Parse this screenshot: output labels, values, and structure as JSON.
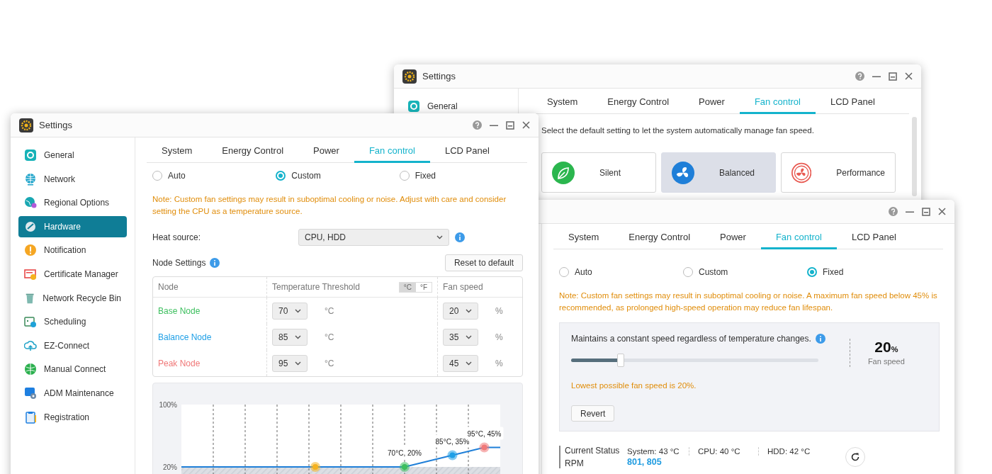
{
  "back_window": {
    "title": "Settings",
    "sidebar": {
      "items": [
        {
          "label": "General",
          "selected": false
        }
      ]
    },
    "tabs": [
      {
        "label": "System",
        "selected": false
      },
      {
        "label": "Energy Control",
        "selected": false
      },
      {
        "label": "Power",
        "selected": false
      },
      {
        "label": "Fan control",
        "selected": true
      },
      {
        "label": "LCD Panel",
        "selected": false
      }
    ],
    "description": "Select the default setting to let the system automatically manage fan speed.",
    "presets": [
      {
        "label": "Silent",
        "selected": false
      },
      {
        "label": "Balanced",
        "selected": true
      },
      {
        "label": "Performance",
        "selected": false
      }
    ]
  },
  "left_window": {
    "title": "Settings",
    "sidebar": {
      "items": [
        {
          "label": "General",
          "selected": false
        },
        {
          "label": "Network",
          "selected": false
        },
        {
          "label": "Regional Options",
          "selected": false
        },
        {
          "label": "Hardware",
          "selected": true
        },
        {
          "label": "Notification",
          "selected": false
        },
        {
          "label": "Certificate Manager",
          "selected": false
        },
        {
          "label": "Network Recycle Bin",
          "selected": false
        },
        {
          "label": "Scheduling",
          "selected": false
        },
        {
          "label": "EZ-Connect",
          "selected": false
        },
        {
          "label": "Manual Connect",
          "selected": false
        },
        {
          "label": "ADM Maintenance",
          "selected": false
        },
        {
          "label": "Registration",
          "selected": false
        }
      ]
    },
    "tabs": [
      {
        "label": "System",
        "selected": false
      },
      {
        "label": "Energy Control",
        "selected": false
      },
      {
        "label": "Power",
        "selected": false
      },
      {
        "label": "Fan control",
        "selected": true
      },
      {
        "label": "LCD Panel",
        "selected": false
      }
    ],
    "modes": [
      {
        "label": "Auto",
        "selected": false
      },
      {
        "label": "Custom",
        "selected": true
      },
      {
        "label": "Fixed",
        "selected": false
      }
    ],
    "note": "Note: Custom fan settings may result in suboptimal cooling or noise. Adjust with care and consider setting the CPU as a temperature source.",
    "heat_source": {
      "label": "Heat source:",
      "value": "CPU, HDD"
    },
    "node_settings": {
      "label": "Node Settings",
      "reset_button": "Reset to default",
      "columns": [
        "Node",
        "Temperature Threshold",
        "Fan speed"
      ],
      "unit_toggle": [
        {
          "label": "°C",
          "selected": true
        },
        {
          "label": "°F",
          "selected": false
        }
      ],
      "rows": [
        {
          "name": "Base Node",
          "color": "#3cbf5e",
          "temperature": "70",
          "temp_unit": "°C",
          "fan_speed": "20",
          "speed_unit": "%"
        },
        {
          "name": "Balance Node",
          "color": "#1e9fe6",
          "temperature": "85",
          "temp_unit": "°C",
          "fan_speed": "35",
          "speed_unit": "%"
        },
        {
          "name": "Peak Node",
          "color": "#f07878",
          "temperature": "95",
          "temp_unit": "°C",
          "fan_speed": "45",
          "speed_unit": "%"
        }
      ]
    },
    "curve_graph": {
      "axis_labels": [
        "100%",
        "20%"
      ],
      "point_labels": [
        "70°C, 20%",
        "85°C, 35%",
        "95°C, 45%"
      ]
    }
  },
  "right_window": {
    "tabs": [
      {
        "label": "System",
        "selected": false
      },
      {
        "label": "Energy Control",
        "selected": false
      },
      {
        "label": "Power",
        "selected": false
      },
      {
        "label": "Fan control",
        "selected": true
      },
      {
        "label": "LCD Panel",
        "selected": false
      }
    ],
    "modes": [
      {
        "label": "Auto",
        "selected": false
      },
      {
        "label": "Custom",
        "selected": false
      },
      {
        "label": "Fixed",
        "selected": true
      }
    ],
    "note": "Note: Custom fan settings may result in suboptimal cooling or noise. A maximum fan speed below 45% is recommended, as prolonged high-speed operation may reduce fan lifespan.",
    "fixed_panel": {
      "description": "Maintains a constant speed regardless of temperature changes.",
      "level": 0.2,
      "value": "20",
      "unit": "%",
      "caption": "Fan speed",
      "hint": "Lowest possible fan speed is 20%.",
      "revert_button": "Revert"
    },
    "status": {
      "label": "Current Status",
      "rpm_label": "RPM",
      "readings": [
        "System: 43 °C",
        "CPU: 40 °C",
        "HDD: 42 °C"
      ],
      "rpm": "801, 805"
    }
  }
}
